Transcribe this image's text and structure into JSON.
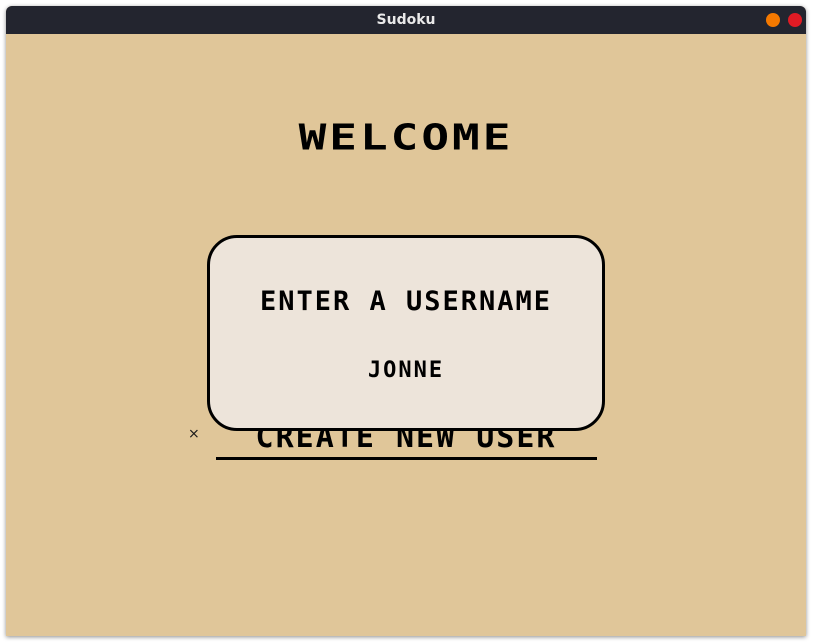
{
  "window": {
    "title": "Sudoku"
  },
  "screen": {
    "heading": "WELCOME",
    "create_user_label": "CREATE NEW USER",
    "marker_glyph": "⨯"
  },
  "dialog": {
    "title": "ENTER A USERNAME",
    "username_value": "JONNE"
  },
  "colors": {
    "background": "#e0c699",
    "titlebar": "#23252f",
    "dialog_fill": "#ede4da",
    "minimize": "#f57900",
    "close": "#e01b24"
  }
}
